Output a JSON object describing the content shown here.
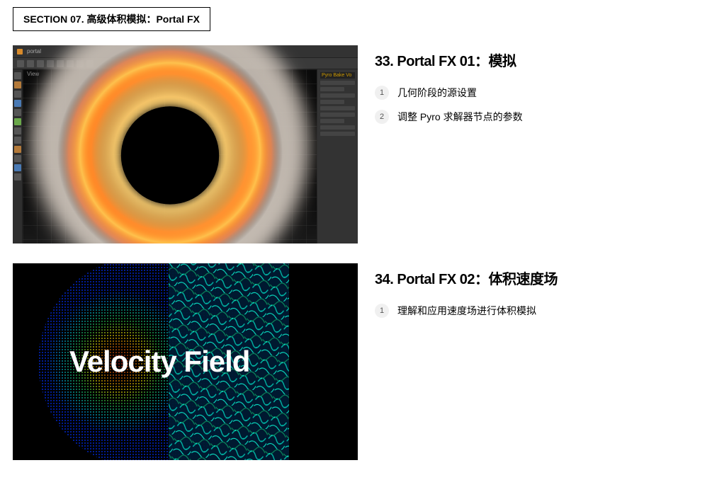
{
  "section_header": "SECTION 07. 高级体积模拟：Portal FX",
  "lesson1": {
    "title": "33. Portal FX 01：模拟",
    "points": [
      {
        "n": "1",
        "text": "几何阶段的源设置"
      },
      {
        "n": "2",
        "text": "调整 Pyro 求解器节点的参数"
      }
    ],
    "thumb": {
      "app_top_left": "portal",
      "viewport_label": "View",
      "right_panel_title": "Pyro Bake Vo"
    }
  },
  "lesson2": {
    "title": "34. Portal FX 02：体积速度场",
    "points": [
      {
        "n": "1",
        "text": "理解和应用速度场进行体积模拟"
      }
    ],
    "thumb_text": "Velocity Field"
  }
}
